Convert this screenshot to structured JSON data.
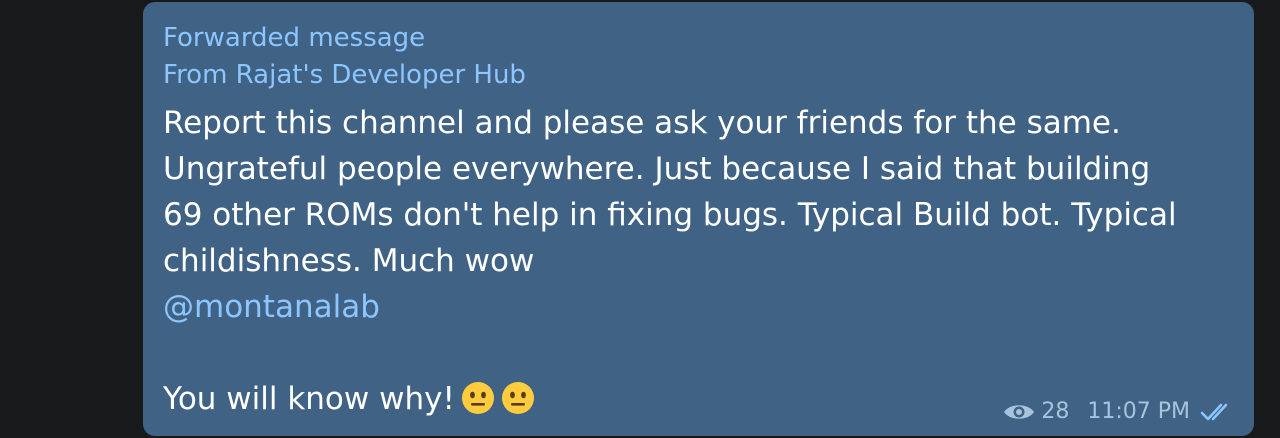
{
  "message": {
    "forward_label": "Forwarded message",
    "forward_from": "From Rajat's Developer Hub",
    "text_lines": [
      "Report this channel and please ask your friends for the same.",
      "Ungrateful people everywhere. Just because I said that building",
      "69 other ROMs don't help in fixing bugs. Typical Build bot. Typical",
      "childishness. Much wow"
    ],
    "mention": "@montanalab",
    "closing_text": "You will know why!",
    "emojis": [
      "neutral-face-emoji",
      "neutral-face-emoji"
    ],
    "views": "28",
    "time": "11:07 PM",
    "status": "read-double-check"
  },
  "colors": {
    "background": "#17191b",
    "bubble": "#3f6285",
    "accent_link": "#8dc6ff",
    "meta": "#a9c3dd"
  }
}
